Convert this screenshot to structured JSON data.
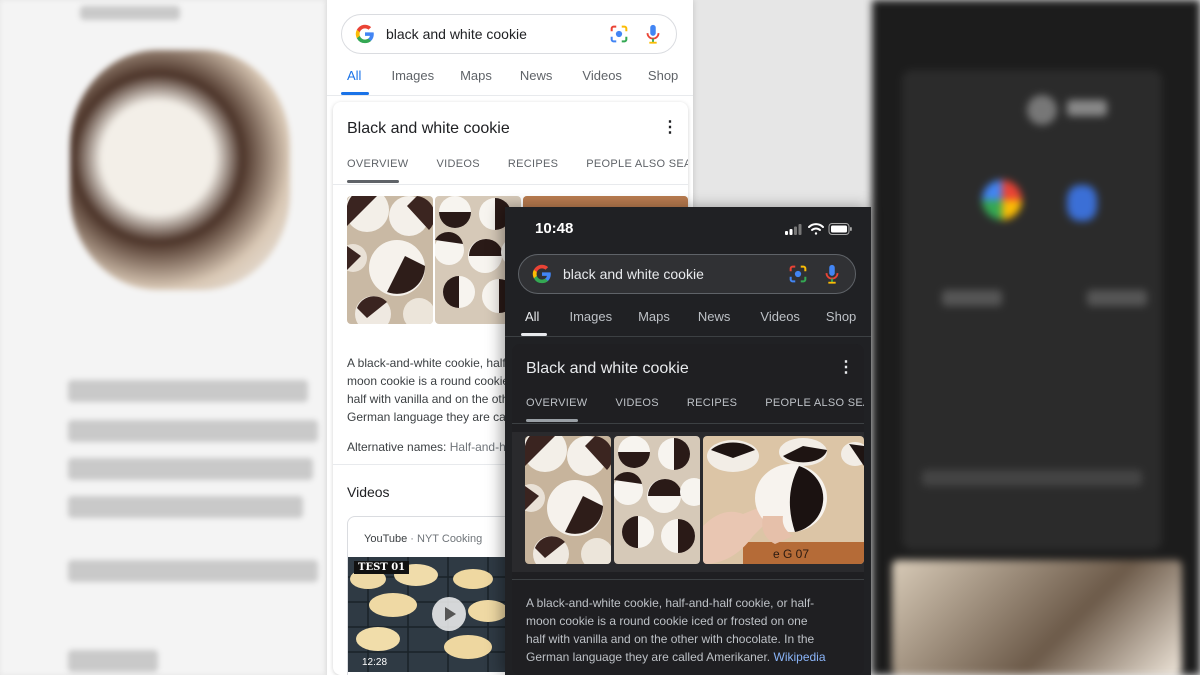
{
  "colors": {
    "google_blue": "#1a73e8",
    "google_red": "#ea4335",
    "google_yellow": "#fbbc05",
    "google_green": "#34a853",
    "dark_bg": "#202124",
    "dark_link": "#8ab4f8"
  },
  "icons": [
    "google-g-icon",
    "google-lens-icon",
    "microphone-icon",
    "more-vert-icon",
    "play-icon",
    "cellular-signal-icon",
    "wifi-icon",
    "battery-icon"
  ],
  "light": {
    "search": {
      "query": "black and white cookie"
    },
    "tabs": [
      {
        "label": "All",
        "active": true
      },
      {
        "label": "Images"
      },
      {
        "label": "Maps"
      },
      {
        "label": "News"
      },
      {
        "label": "Videos"
      },
      {
        "label": "Shop"
      }
    ],
    "panel": {
      "title": "Black and white cookie",
      "subtabs": [
        "OVERVIEW",
        "VIDEOS",
        "RECIPES",
        "PEOPLE ALSO SEAR"
      ],
      "description_lines": [
        "A black-and-white cookie, half-and-half cookie, or half-",
        "moon cookie is a round cookie iced or frosted on one",
        "half with vanilla and on the other with chocolate. In the",
        "German language they are called Amerikaner. Wikipedia"
      ],
      "alt_names_label": "Alternative names:",
      "alt_names_value": "Half-and-half cookie, Half-moon cookie",
      "videos_heading": "Videos",
      "video": {
        "source": "YouTube",
        "separator": " · ",
        "channel": "NYT Cooking",
        "badge": "TEST 01",
        "duration": "12:28"
      }
    }
  },
  "dark": {
    "status": {
      "time": "10:48"
    },
    "search": {
      "query": "black and white cookie"
    },
    "tabs": [
      {
        "label": "All",
        "active": true
      },
      {
        "label": "Images"
      },
      {
        "label": "Maps"
      },
      {
        "label": "News"
      },
      {
        "label": "Videos"
      },
      {
        "label": "Shop"
      }
    ],
    "panel": {
      "title": "Black and white cookie",
      "subtabs": [
        "OVERVIEW",
        "VIDEOS",
        "RECIPES",
        "PEOPLE ALSO SEAR"
      ],
      "description_lines": [
        "A black-and-white cookie, half-and-half cookie, or half-",
        "moon cookie is a round cookie iced or frosted on one",
        "half with vanilla and on the other with chocolate. In the"
      ],
      "description_last": "German language they are called Amerikaner.",
      "wiki_link": "Wikipedia"
    }
  }
}
